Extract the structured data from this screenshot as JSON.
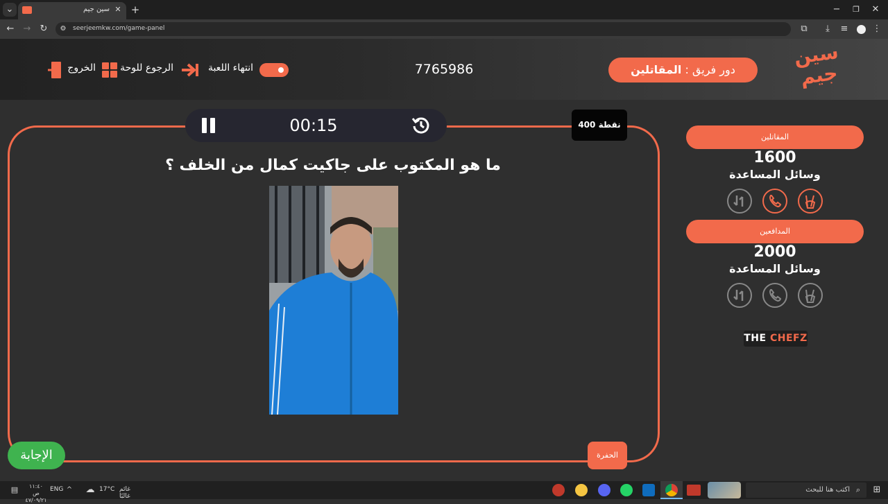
{
  "browser": {
    "tab_title": "سين جيم",
    "url": "seerjeemkw.com/game-panel"
  },
  "header": {
    "logo_line1": "سين",
    "logo_line2": "جيم",
    "turn_label": "دور فريق :",
    "turn_team": "المقاتلين",
    "game_code": "7765986",
    "end_game_label": "انتهاء اللعبة",
    "back_to_board_label": "الرجوع للوحة",
    "exit_label": "الخروج"
  },
  "question": {
    "timer": "00:15",
    "points": "400 نقطة",
    "text": "ما هو المكتوب على جاكيت كمال من الخلف ؟",
    "hole_label": "الحفرة",
    "answer_label": "الإجابة"
  },
  "teams": [
    {
      "name": "المقاتلين",
      "score": "1600",
      "aids_label": "وسائل المساعدة",
      "aids_active": [
        true,
        true,
        false
      ]
    },
    {
      "name": "المدافعين",
      "score": "2000",
      "aids_label": "وسائل المساعدة",
      "aids_active": [
        false,
        false,
        false
      ]
    }
  ],
  "sponsor": {
    "prefix": "THE",
    "name": "CHEFZ"
  },
  "taskbar": {
    "search_placeholder": "اكتب هنا للبحث",
    "weather_temp": "17°C",
    "weather_text": "غائم غالبًا",
    "language": "ENG",
    "time": "١١:٤٠ ص",
    "date": "٤٧/٠٩/٢١"
  },
  "colors": {
    "accent": "#f26a4b",
    "answer_green": "#3fb34f",
    "background": "#2f2f2f"
  }
}
